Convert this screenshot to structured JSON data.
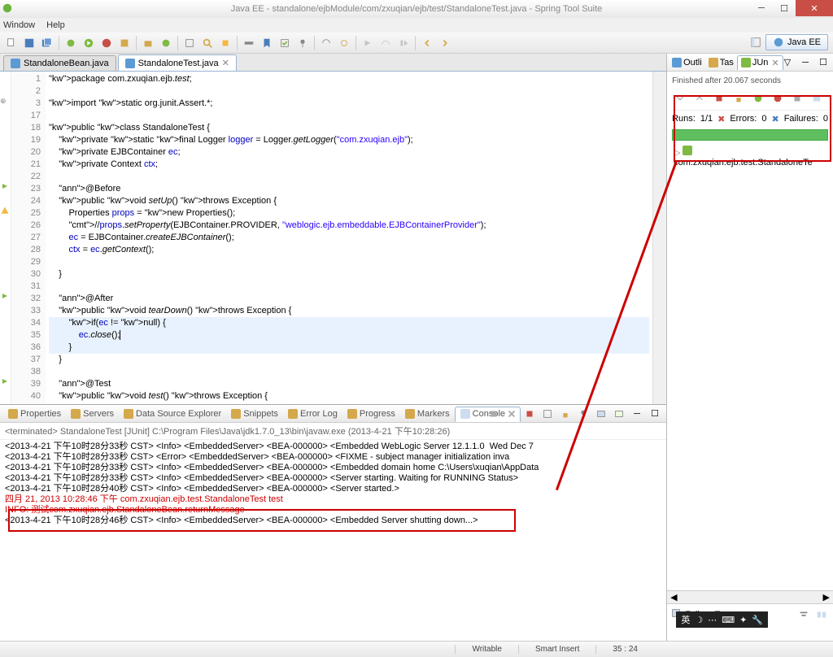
{
  "title": "Java EE - standalone/ejbModule/com/zxuqian/ejb/test/StandaloneTest.java - Spring Tool Suite",
  "menu": {
    "window": "Window",
    "help": "Help"
  },
  "perspective": {
    "label": "Java EE"
  },
  "editor_tabs": [
    {
      "label": "StandaloneBean.java",
      "active": false
    },
    {
      "label": "StandaloneTest.java",
      "active": true
    }
  ],
  "code": {
    "lines": [
      {
        "n": "1",
        "t": "package com.zxuqian.ejb.test;",
        "kind": "pkg"
      },
      {
        "n": "2",
        "t": ""
      },
      {
        "n": "3",
        "t": "import static org.junit.Assert.*;",
        "kind": "imp",
        "marker": "expand"
      },
      {
        "n": "17",
        "t": ""
      },
      {
        "n": "18",
        "t": "public class StandaloneTest {",
        "kind": "h"
      },
      {
        "n": "19",
        "t": "    private static final Logger logger = Logger.getLogger(\"com.zxuqian.ejb\");"
      },
      {
        "n": "20",
        "t": "    private EJBContainer ec;"
      },
      {
        "n": "21",
        "t": "    private Context ctx;"
      },
      {
        "n": "22",
        "t": ""
      },
      {
        "n": "23",
        "t": "    @Before",
        "marker": "tri"
      },
      {
        "n": "24",
        "t": "    public void setUp() throws Exception {"
      },
      {
        "n": "25",
        "t": "        Properties props = new Properties();",
        "marker": "warn"
      },
      {
        "n": "26",
        "t": "        //props.setProperty(EJBContainer.PROVIDER, \"weblogic.ejb.embeddable.EJBContainerProvider\");"
      },
      {
        "n": "27",
        "t": "        ec = EJBContainer.createEJBContainer();"
      },
      {
        "n": "28",
        "t": "        ctx = ec.getContext();"
      },
      {
        "n": "29",
        "t": ""
      },
      {
        "n": "30",
        "t": "    }"
      },
      {
        "n": "31",
        "t": ""
      },
      {
        "n": "32",
        "t": "    @After",
        "marker": "tri"
      },
      {
        "n": "33",
        "t": "    public void tearDown() throws Exception {"
      },
      {
        "n": "34",
        "t": "        if(ec != null) {",
        "hl": true
      },
      {
        "n": "35",
        "t": "            ec.close();",
        "hl": true,
        "cursor": true
      },
      {
        "n": "36",
        "t": "        }",
        "hl": true
      },
      {
        "n": "37",
        "t": "    }"
      },
      {
        "n": "38",
        "t": ""
      },
      {
        "n": "39",
        "t": "    @Test",
        "marker": "tri"
      },
      {
        "n": "40",
        "t": "    public void test() throws Exception {"
      }
    ]
  },
  "bottom_tabs": [
    "Properties",
    "Servers",
    "Data Source Explorer",
    "Snippets",
    "Error Log",
    "Progress",
    "Markers",
    "Console"
  ],
  "bottom_active": "Console",
  "console": {
    "header": "<terminated> StandaloneTest [JUnit] C:\\Program Files\\Java\\jdk1.7.0_13\\bin\\javaw.exe (2013-4-21 下午10:28:26)",
    "lines": [
      "<2013-4-21 下午10时28分33秒 CST> <Info> <EmbeddedServer> <BEA-000000> <Embedded WebLogic Server 12.1.1.0  Wed Dec 7",
      "<2013-4-21 下午10时28分33秒 CST> <Error> <EmbeddedServer> <BEA-000000> <FIXME - subject manager initialization inva",
      "<2013-4-21 下午10时28分33秒 CST> <Info> <EmbeddedServer> <BEA-000000> <Embedded domain home C:\\Users\\xuqian\\AppData",
      "<2013-4-21 下午10时28分33秒 CST> <Info> <EmbeddedServer> <BEA-000000> <Server starting. Waiting for RUNNING Status>",
      "<2013-4-21 下午10时28分40秒 CST> <Info> <EmbeddedServer> <BEA-000000> <Server started.>"
    ],
    "red1": "四月 21, 2013 10:28:46 下午 com.zxuqian.ejb.test.StandaloneTest test",
    "red2": "INFO: 测试com.zxuqian.ejb.StandaloneBean.returnMessage",
    "after": "<2013-4-21 下午10时28分46秒 CST> <Info> <EmbeddedServer> <BEA-000000> <Embedded Server shutting down...>"
  },
  "right_tabs": [
    "Outli",
    "Tas",
    "JUn"
  ],
  "junit": {
    "header": "Finished after 20.067 seconds",
    "runs_label": "Runs:",
    "runs": "1/1",
    "errors_label": "Errors:",
    "errors": "0",
    "failures_label": "Failures:",
    "failures": "0",
    "test_item": "com.zxuqian.ejb.test.StandaloneTe",
    "failure_trace": "Failure Trace"
  },
  "status": {
    "writable": "Writable",
    "insert": "Smart Insert",
    "pos": "35 : 24"
  },
  "ime": "英"
}
